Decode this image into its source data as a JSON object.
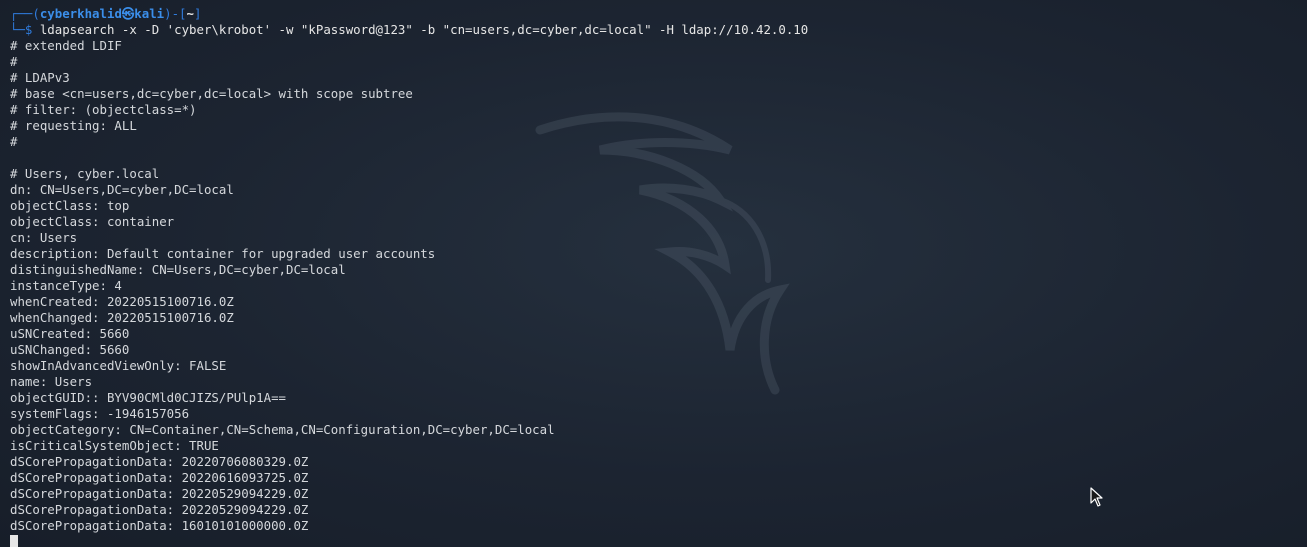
{
  "prompt": {
    "top_prefix": "┌──(",
    "user": "cyberkhalid",
    "at": "㉿",
    "host": "kali",
    "mid": ")-[",
    "path": "~",
    "end": "]",
    "bottom_prefix": "└─$ ",
    "command": "ldapsearch -x -D 'cyber\\krobot' -w \"kPassword@123\" -b \"cn=users,dc=cyber,dc=local\" -H ldap://10.42.0.10"
  },
  "output_lines": [
    "# extended LDIF",
    "#",
    "# LDAPv3",
    "# base <cn=users,dc=cyber,dc=local> with scope subtree",
    "# filter: (objectclass=*)",
    "# requesting: ALL",
    "#",
    "",
    "# Users, cyber.local",
    "dn: CN=Users,DC=cyber,DC=local",
    "objectClass: top",
    "objectClass: container",
    "cn: Users",
    "description: Default container for upgraded user accounts",
    "distinguishedName: CN=Users,DC=cyber,DC=local",
    "instanceType: 4",
    "whenCreated: 20220515100716.0Z",
    "whenChanged: 20220515100716.0Z",
    "uSNCreated: 5660",
    "uSNChanged: 5660",
    "showInAdvancedViewOnly: FALSE",
    "name: Users",
    "objectGUID:: BYV90CMld0CJIZS/PUlp1A==",
    "systemFlags: -1946157056",
    "objectCategory: CN=Container,CN=Schema,CN=Configuration,DC=cyber,DC=local",
    "isCriticalSystemObject: TRUE",
    "dSCorePropagationData: 20220706080329.0Z",
    "dSCorePropagationData: 20220616093725.0Z",
    "dSCorePropagationData: 20220529094229.0Z",
    "dSCorePropagationData: 20220529094229.0Z",
    "dSCorePropagationData: 16010101000000.0Z"
  ]
}
